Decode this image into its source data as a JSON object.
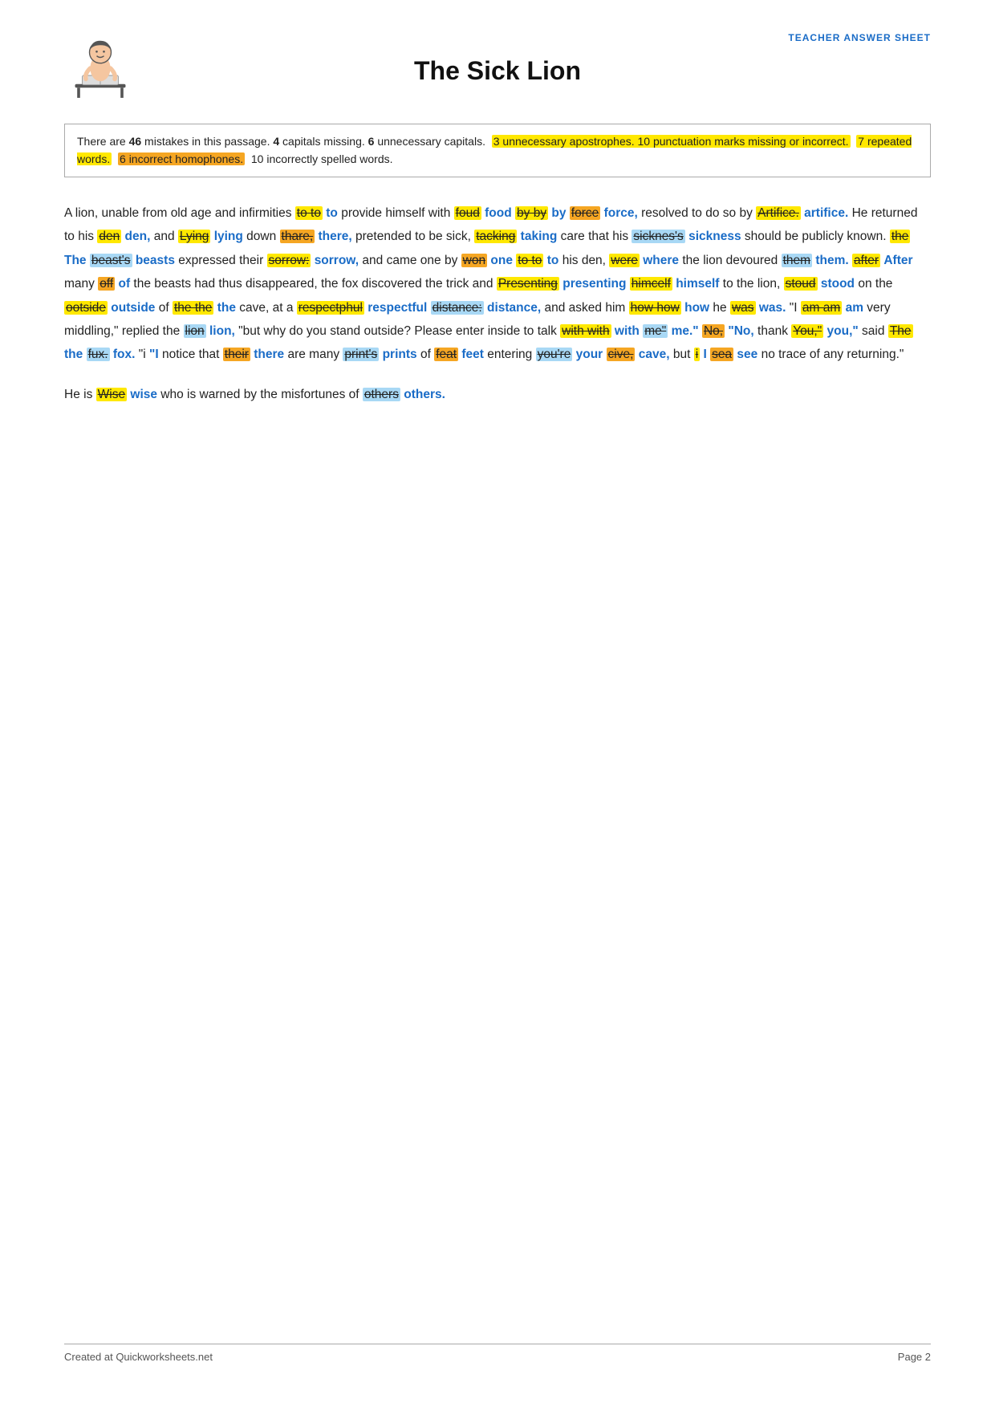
{
  "header": {
    "teacher_label": "TEACHER ANSWER SHEET",
    "title": "The Sick Lion"
  },
  "info_box": {
    "text": "There are 46 mistakes in this passage. 4 capitals missing. 6 unnecessary capitals.  3 unnecessary apostrophes. 10 punctuation marks missing or incorrect.  7 repeated words.  6 incorrect homophones.  10 incorrectly spelled words."
  },
  "footer": {
    "left": "Created at Quickworksheets.net",
    "right": "Page 2"
  }
}
